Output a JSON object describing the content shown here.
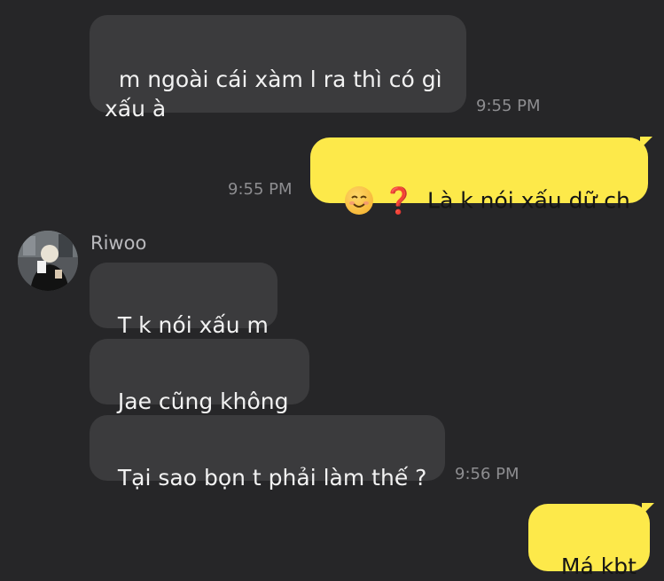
{
  "messages": [
    {
      "text": "m ngoài cái xàm l ra thì có gì\nxấu à",
      "time": "9:55 PM"
    },
    {
      "emoji_smile": "smiling-face-icon",
      "emoji_question": "❓",
      "text": "Là k nói xấu dữ ch",
      "time": "9:55 PM"
    },
    {
      "sender": "Riwoo",
      "text": "T k nói xấu m"
    },
    {
      "text": "Jae cũng không"
    },
    {
      "text": "Tại sao bọn t phải làm thế ?",
      "time": "9:56 PM"
    },
    {
      "text": "Má kbt"
    }
  ],
  "colors": {
    "background": "#262628",
    "incoming_bubble": "#3b3b3d",
    "outgoing_bubble": "#fde94a",
    "timestamp": "#8d8d90"
  }
}
